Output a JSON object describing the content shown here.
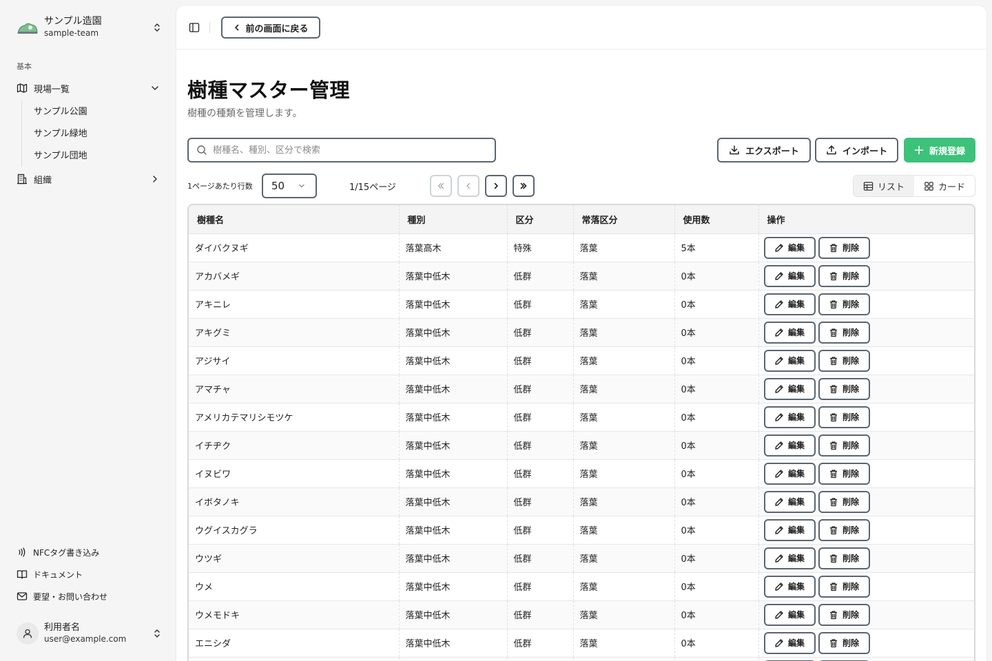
{
  "team": {
    "name": "サンプル造園",
    "id": "sample-team"
  },
  "sidebar": {
    "section_label": "基本",
    "sites_label": "現場一覧",
    "sites": [
      "サンプル公園",
      "サンプル緑地",
      "サンプル団地"
    ],
    "org_label": "組織",
    "footer": {
      "nfc": "NFCタグ書き込み",
      "docs": "ドキュメント",
      "contact": "要望・お問い合わせ"
    },
    "user": {
      "name": "利用者名",
      "email": "user@example.com"
    }
  },
  "topbar": {
    "back_label": "前の画面に戻る"
  },
  "page": {
    "title": "樹種マスター管理",
    "subtitle": "樹種の種類を管理します。"
  },
  "toolbar": {
    "search_placeholder": "樹種名、種別、区分で検索",
    "export_label": "エクスポート",
    "import_label": "インポート",
    "new_label": "新規登録"
  },
  "pagination": {
    "rows_label": "1ページあたり行数",
    "rows_value": "50",
    "page_info": "1/15ページ"
  },
  "view": {
    "list_label": "リスト",
    "card_label": "カード"
  },
  "table": {
    "headers": [
      "樹種名",
      "種別",
      "区分",
      "常落区分",
      "使用数",
      "操作"
    ],
    "edit_label": "編集",
    "delete_label": "削除",
    "rows": [
      [
        "ダイバクヌギ",
        "落葉高木",
        "特殊",
        "落葉",
        "5本"
      ],
      [
        "アカバメギ",
        "落葉中低木",
        "低群",
        "落葉",
        "0本"
      ],
      [
        "アキニレ",
        "落葉中低木",
        "低群",
        "落葉",
        "0本"
      ],
      [
        "アキグミ",
        "落葉中低木",
        "低群",
        "落葉",
        "0本"
      ],
      [
        "アジサイ",
        "落葉中低木",
        "低群",
        "落葉",
        "0本"
      ],
      [
        "アマチャ",
        "落葉中低木",
        "低群",
        "落葉",
        "0本"
      ],
      [
        "アメリカテマリシモツケ",
        "落葉中低木",
        "低群",
        "落葉",
        "0本"
      ],
      [
        "イチヂク",
        "落葉中低木",
        "低群",
        "落葉",
        "0本"
      ],
      [
        "イヌビワ",
        "落葉中低木",
        "低群",
        "落葉",
        "0本"
      ],
      [
        "イボタノキ",
        "落葉中低木",
        "低群",
        "落葉",
        "0本"
      ],
      [
        "ウグイスカグラ",
        "落葉中低木",
        "低群",
        "落葉",
        "0本"
      ],
      [
        "ウツギ",
        "落葉中低木",
        "低群",
        "落葉",
        "0本"
      ],
      [
        "ウメ",
        "落葉中低木",
        "低群",
        "落葉",
        "0本"
      ],
      [
        "ウメモドキ",
        "落葉中低木",
        "低群",
        "落葉",
        "0本"
      ],
      [
        "エニシダ",
        "落葉中低木",
        "低群",
        "落葉",
        "0本"
      ],
      [
        "",
        "",
        "",
        "",
        ""
      ]
    ]
  },
  "colors": {
    "primary": "#3cc27a",
    "border": "#5a6570"
  }
}
